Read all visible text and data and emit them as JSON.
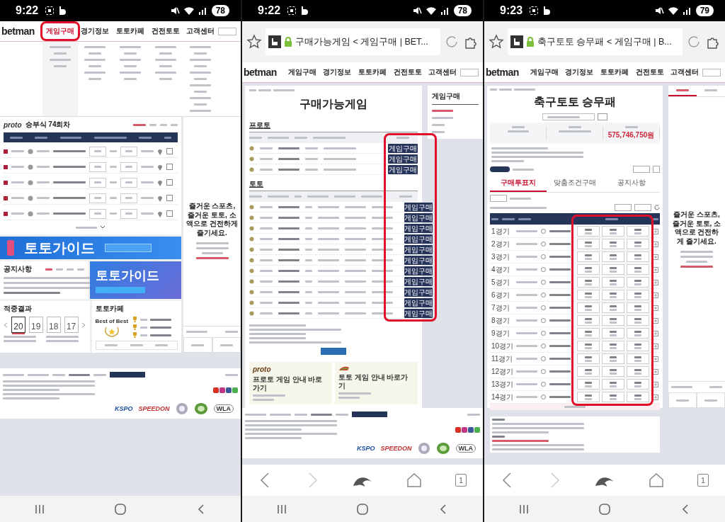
{
  "phones": [
    {
      "kind": "home",
      "status_bar": {
        "time": "9:22",
        "battery": "78"
      },
      "header": {
        "logo": "betman",
        "nav": [
          {
            "label": "게임구매",
            "selected": true,
            "highlighted": true
          },
          {
            "label": "경기정보",
            "selected": false,
            "highlighted": false
          },
          {
            "label": "토토카페",
            "selected": false,
            "highlighted": false
          },
          {
            "label": "건전토토",
            "selected": false,
            "highlighted": false
          },
          {
            "label": "고객센터",
            "selected": false,
            "highlighted": false
          }
        ]
      },
      "proto_panel": {
        "brand": "proto",
        "title": "승부식 74회차"
      },
      "guide_banner": {
        "title": "토토가이드"
      },
      "notice": {
        "title": "공지사항"
      },
      "guide_card": {
        "title": "토토가이드"
      },
      "results": {
        "title": "적중결과",
        "dates": [
          "20",
          "19",
          "18",
          "17"
        ]
      },
      "cafe": {
        "title": "토토카페",
        "award": "Best of Best"
      },
      "side_message": "즐거운 스포츠, 즐거운 토토, 소액으로 건전하게 즐기세요.",
      "footer_logos": [
        "KSPO",
        "SPEEDON",
        "WLA"
      ]
    },
    {
      "kind": "list",
      "status_bar": {
        "time": "9:22",
        "battery": "78"
      },
      "address_bar": {
        "title": "구매가능게임 < 게임구매 | BET..."
      },
      "header": {
        "logo": "betman",
        "nav": [
          {
            "label": "게임구매",
            "selected": false,
            "highlighted": false
          },
          {
            "label": "경기정보",
            "selected": false,
            "highlighted": false
          },
          {
            "label": "토토카페",
            "selected": false,
            "highlighted": false
          },
          {
            "label": "건전토토",
            "selected": false,
            "highlighted": false
          },
          {
            "label": "고객센터",
            "selected": false,
            "highlighted": false
          }
        ]
      },
      "page_title": "구매가능게임",
      "side_menu": {
        "title": "게임구매"
      },
      "sections": [
        {
          "title": "프로토",
          "buttons": [
            "게임구매",
            "게임구매",
            "게임구매"
          ]
        },
        {
          "title": "토토",
          "buttons": [
            "게임구매",
            "게임구매",
            "게임구매",
            "게임구매",
            "게임구매",
            "게임구매",
            "게임구매",
            "게임구매",
            "게임구매",
            "게임구매",
            "게임구매"
          ]
        }
      ],
      "buy_column_highlighted": true,
      "promos": [
        {
          "brand": "proto",
          "title": "프로토 게임 안내 바로가기"
        },
        {
          "title": "토토 게임 안내 바로가기"
        }
      ],
      "footer_logos": [
        "KSPO",
        "SPEEDON",
        "WLA"
      ],
      "browser_nav": {
        "tab_count": "1"
      }
    },
    {
      "kind": "detail",
      "status_bar": {
        "time": "9:23",
        "battery": "79"
      },
      "address_bar": {
        "title": "축구토토 승무패 < 게임구매 | B..."
      },
      "header": {
        "logo": "betman",
        "nav": [
          {
            "label": "게임구매",
            "selected": false,
            "highlighted": false
          },
          {
            "label": "경기정보",
            "selected": false,
            "highlighted": false
          },
          {
            "label": "토토카페",
            "selected": false,
            "highlighted": false
          },
          {
            "label": "건전토토",
            "selected": false,
            "highlighted": false
          },
          {
            "label": "고객센터",
            "selected": false,
            "highlighted": false
          }
        ]
      },
      "page_title": "축구토토 승무패",
      "jackpot": "575,746,750원",
      "tabs": [
        {
          "label": "구매투표지",
          "selected": true
        },
        {
          "label": "맞춤조건구매",
          "selected": false
        },
        {
          "label": "공지사항",
          "selected": false
        }
      ],
      "matches": [
        "1경기",
        "2경기",
        "3경기",
        "4경기",
        "5경기",
        "6경기",
        "7경기",
        "8경기",
        "9경기",
        "10경기",
        "11경기",
        "12경기",
        "13경기",
        "14경기"
      ],
      "odds_highlighted": true,
      "side_message": "즐거운 스포츠, 즐거운 토토, 소액으로 건전하게 즐기세요.",
      "browser_nav": {
        "tab_count": "1"
      }
    }
  ]
}
